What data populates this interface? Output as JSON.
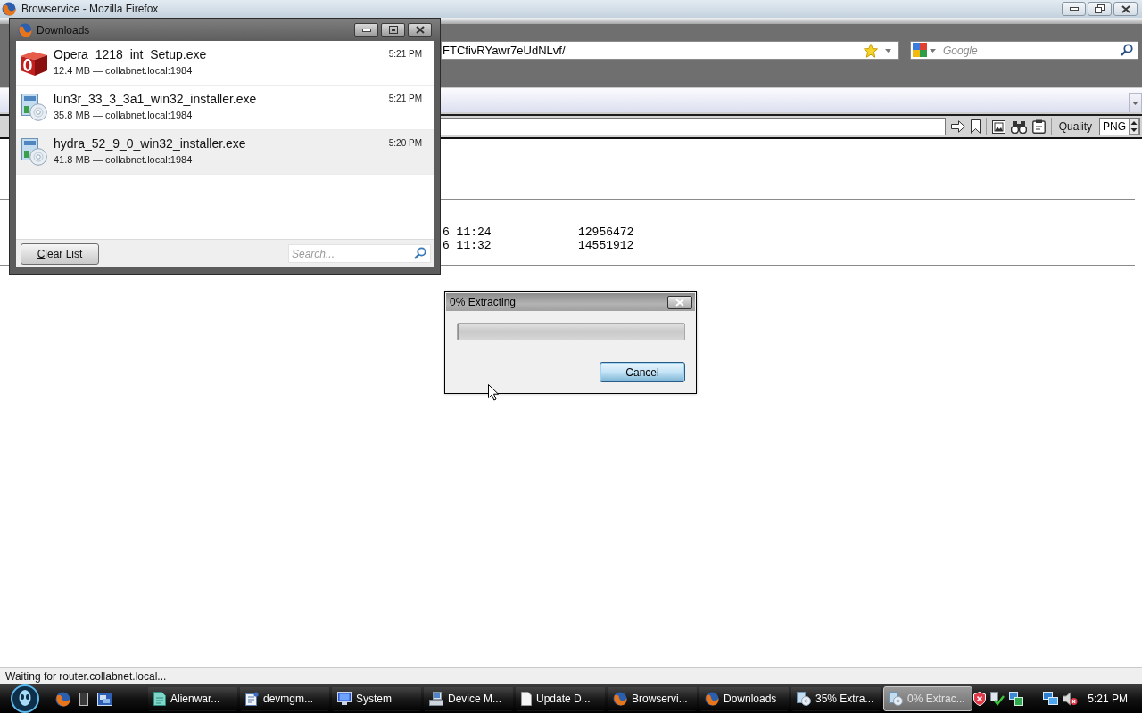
{
  "browser": {
    "title": "Browservice - Mozilla Firefox",
    "address": {
      "value": "FTCfivRYawr7eUdNLvf/"
    },
    "search": {
      "placeholder": "Google"
    },
    "page_toolbar": {
      "quality_label": "Quality",
      "format": "PNG"
    },
    "listing": {
      "rows": [
        {
          "cells": [
            "6 11:24",
            "12956472"
          ]
        },
        {
          "cells": [
            "6 11:32",
            "14551912"
          ]
        }
      ]
    },
    "status_bar": "Waiting for router.collabnet.local..."
  },
  "downloads_window": {
    "title": "Downloads",
    "items": [
      {
        "name": "Opera_1218_int_Setup.exe",
        "details": "12.4 MB — collabnet.local:1984",
        "time": "5:21 PM",
        "kind": "opera",
        "selected": false
      },
      {
        "name": "lun3r_33_3_3a1_win32_installer.exe",
        "details": "35.8 MB — collabnet.local:1984",
        "time": "5:21 PM",
        "kind": "installer",
        "selected": false
      },
      {
        "name": "hydra_52_9_0_win32_installer.exe",
        "details": "41.8 MB — collabnet.local:1984",
        "time": "5:20 PM",
        "kind": "installer",
        "selected": true
      }
    ],
    "clear_button": "Clear List",
    "search": {
      "placeholder": "Search..."
    }
  },
  "extract_dialog": {
    "title": "0% Extracting",
    "progress": {
      "level": 0
    },
    "cancel_button": "Cancel"
  },
  "taskbar": {
    "tasks": [
      {
        "label": "Alienwar...",
        "kind": "document",
        "selected": false
      },
      {
        "label": "devmgm...",
        "kind": "script",
        "selected": false
      },
      {
        "label": "System",
        "kind": "monitor",
        "selected": false
      },
      {
        "label": "Device M...",
        "kind": "computer",
        "selected": false
      },
      {
        "label": "Update D...",
        "kind": "update",
        "selected": false
      },
      {
        "label": "Browservi...",
        "kind": "firefox",
        "selected": false
      },
      {
        "label": "Downloads",
        "kind": "firefox",
        "selected": false
      },
      {
        "label": "35% Extra...",
        "kind": "installer",
        "selected": false
      },
      {
        "label": "0% Extrac...",
        "kind": "installer",
        "selected": true
      }
    ],
    "clock": "5:21 PM"
  }
}
